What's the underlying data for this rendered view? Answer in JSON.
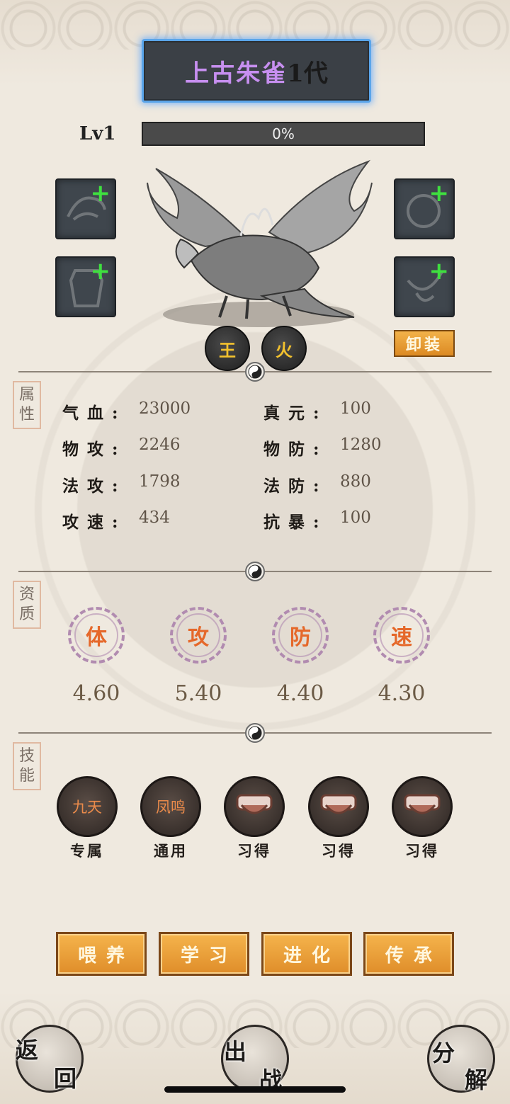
{
  "pet": {
    "name": "上古朱雀",
    "generation": "1代"
  },
  "level": {
    "label": "Lv1",
    "progress_text": "0%",
    "progress": 0
  },
  "elements": [
    "王",
    "火"
  ],
  "unequip_label": "卸装",
  "attributes": {
    "tag": [
      "属",
      "性"
    ],
    "rows": [
      {
        "label": "气血:",
        "value": "23000"
      },
      {
        "label": "真元:",
        "value": "100"
      },
      {
        "label": "物攻:",
        "value": "2246"
      },
      {
        "label": "物防:",
        "value": "1280"
      },
      {
        "label": "法攻:",
        "value": "1798"
      },
      {
        "label": "法防:",
        "value": "880"
      },
      {
        "label": "攻速:",
        "value": "434"
      },
      {
        "label": "抗暴:",
        "value": "100"
      }
    ]
  },
  "aptitude": {
    "tag": [
      "资",
      "质"
    ],
    "items": [
      {
        "label": "体",
        "value": "4.60"
      },
      {
        "label": "攻",
        "value": "5.40"
      },
      {
        "label": "防",
        "value": "4.40"
      },
      {
        "label": "速",
        "value": "4.30"
      }
    ]
  },
  "skills": {
    "tag": [
      "技",
      "能"
    ],
    "items": [
      {
        "name": "九天",
        "type": "专属"
      },
      {
        "name": "凤鸣",
        "type": "通用"
      },
      {
        "name": "",
        "type": "习得"
      },
      {
        "name": "",
        "type": "习得"
      },
      {
        "name": "",
        "type": "习得"
      }
    ]
  },
  "actions": [
    "喂养",
    "学习",
    "进化",
    "传承"
  ],
  "nav": {
    "back": [
      "返",
      "回"
    ],
    "battle": [
      "出",
      "战"
    ],
    "decompose": [
      "分",
      "解"
    ]
  },
  "colors": {
    "title_purple": "#c78ff0",
    "element_gold": "#f2c12e",
    "aptitude_orange": "#e5682a",
    "button_orange": "#df8d2a"
  }
}
